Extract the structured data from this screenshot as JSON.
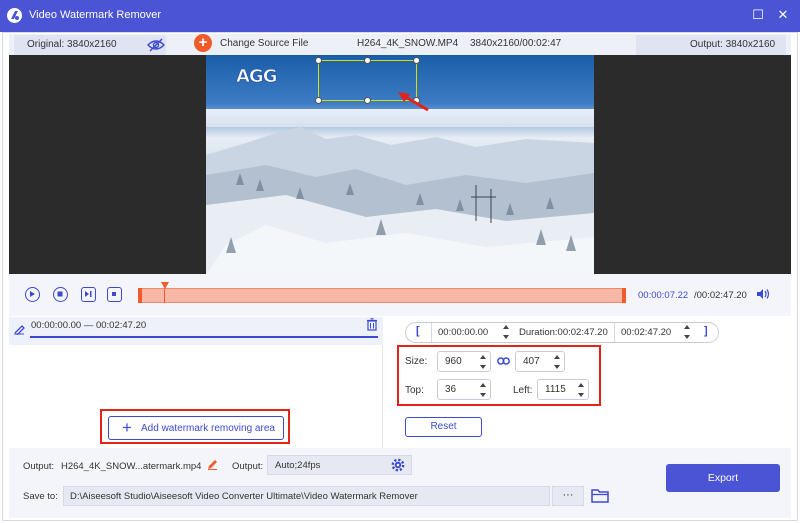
{
  "window": {
    "title": "Video Watermark Remover",
    "minimize": "☐",
    "close": "✕"
  },
  "header": {
    "original": "Original: 3840x2160",
    "change_source": "Change Source File",
    "file_name": "H264_4K_SNOW.MP4",
    "file_meta": "3840x2160/00:02:47",
    "output": "Output: 3840x2160"
  },
  "preview": {
    "logo_text": "AGG"
  },
  "playback": {
    "current_time": "00:00:07.22",
    "total_time": "/00:02:47.20"
  },
  "area_list": {
    "items": [
      {
        "range": "00:00:00.00 — 00:02:47.20"
      }
    ],
    "add_button": "Add watermark removing area"
  },
  "area_settings": {
    "start_bracket": "[",
    "end_bracket": "]",
    "start_time": "00:00:00.00",
    "duration": "Duration:00:02:47.20",
    "end_time": "00:02:47.20",
    "size_label": "Size:",
    "width": "960",
    "height": "407",
    "top_label": "Top:",
    "top": "36",
    "left_label": "Left:",
    "left": "1115",
    "reset": "Reset"
  },
  "bottom": {
    "output_label": "Output:",
    "output_file": "H264_4K_SNOW...atermark.mp4",
    "format_label": "Output:",
    "format_value": "Auto;24fps",
    "save_label": "Save to:",
    "save_path": "D:\\Aiseesoft Studio\\Aiseesoft Video Converter Ultimate\\Video Watermark Remover",
    "browse": "···",
    "export": "Export"
  },
  "colors": {
    "accent": "#4a54d4",
    "highlight_red": "#e2231a",
    "timeline_fill": "#f7b7a7",
    "selection_box": "#d8e000"
  }
}
